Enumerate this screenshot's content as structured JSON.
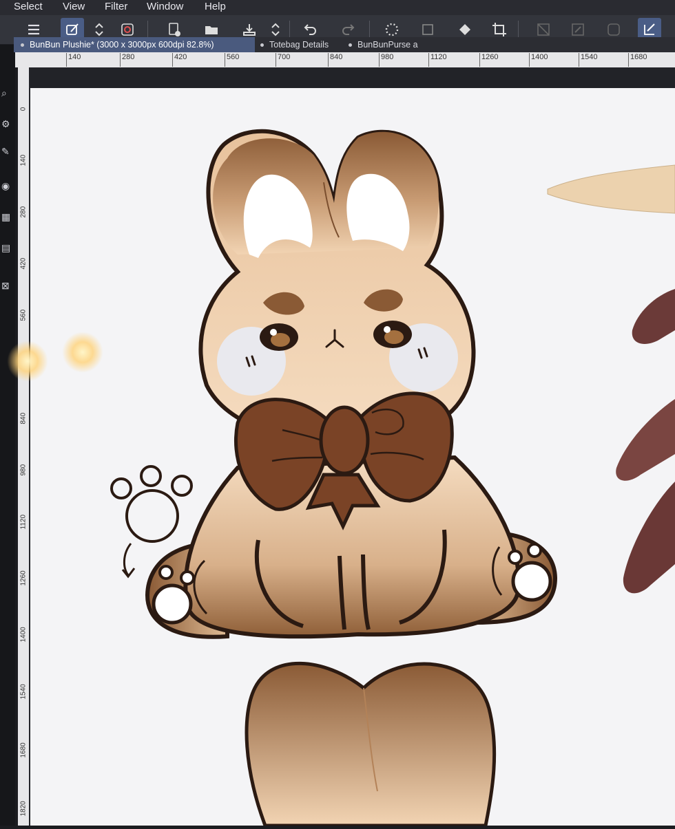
{
  "menu": {
    "items": [
      "Select",
      "View",
      "Filter",
      "Window",
      "Help"
    ]
  },
  "toolbar": {
    "icons": [
      "menu-icon",
      "pen-mode-icon",
      "toggle-icon",
      "spiral-icon",
      "new-canvas-icon",
      "open-folder-icon",
      "save-icon",
      "toggle-icon-2",
      "undo-icon",
      "redo-icon",
      "loading-icon",
      "transform-icon",
      "fill-icon",
      "crop-icon",
      "deselect-icon",
      "eraser-icon",
      "clear-icon",
      "select-tool-icon"
    ]
  },
  "tabs": [
    {
      "label": "BunBun Plushie* (3000 x 3000px 600dpi 82.8%)"
    },
    {
      "label": "Totebag Details"
    },
    {
      "label": "BunBunPurse a"
    }
  ],
  "ruler": {
    "h_ticks": [
      "140",
      "280",
      "420",
      "560",
      "700",
      "840",
      "980",
      "1120",
      "1260",
      "1400",
      "1540",
      "1680"
    ],
    "v_ticks": [
      "0",
      "140",
      "280",
      "420",
      "560",
      "840",
      "980",
      "1120",
      "1260",
      "1400",
      "1540",
      "1680",
      "1820"
    ]
  },
  "colors": {
    "outline": "#2b1a12",
    "fur_light": "#f2d4b3",
    "fur_dark": "#8a5a35",
    "bow": "#7a4326",
    "cheek": "#e9e9ee",
    "canvas": "#f4f4f6"
  }
}
